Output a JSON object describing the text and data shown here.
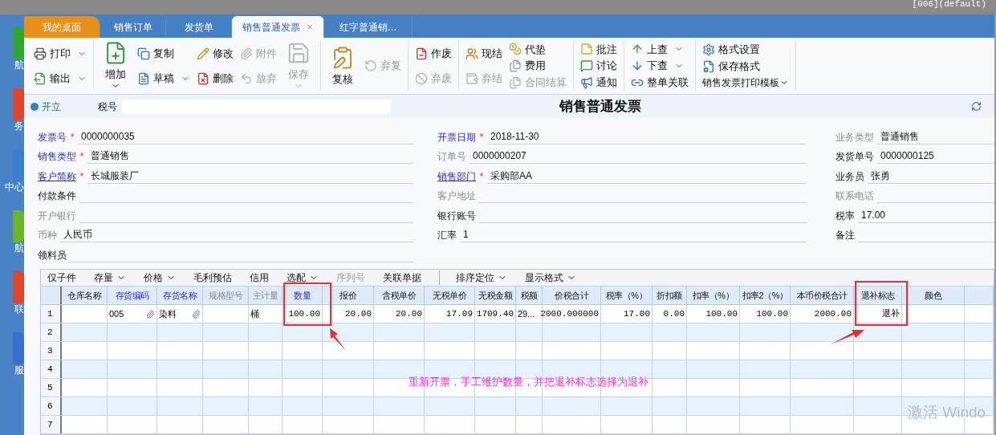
{
  "top_bar": {
    "text": "[006](default)"
  },
  "sidebar": {
    "items": [
      {
        "label": "航",
        "color": "#2fa82f"
      },
      {
        "label": "务",
        "color": "#e0452a"
      },
      {
        "label": "中心",
        "color": "#3a7fd0"
      },
      {
        "label": "航",
        "color": "#6bb52a"
      },
      {
        "label": "联",
        "color": "#e0452a"
      },
      {
        "label": "服",
        "color": "#3a6fd0"
      }
    ]
  },
  "tabs": [
    {
      "label": "我的桌面",
      "selected": false,
      "kind": "home"
    },
    {
      "label": "销售订单",
      "selected": false,
      "kind": "doc"
    },
    {
      "label": "发货单",
      "selected": false,
      "kind": "doc"
    },
    {
      "label": "销售普通发票",
      "selected": true,
      "kind": "doc",
      "close": "×"
    },
    {
      "label": "红字普通销…",
      "selected": false,
      "kind": "doc"
    }
  ],
  "toolbar": {
    "groups": [
      {
        "columns": [
          [
            {
              "label": "打印",
              "disabled": false,
              "dropdown": true
            },
            {
              "label": "输出",
              "disabled": false,
              "dropdown": true
            }
          ]
        ]
      },
      {
        "columns": [
          [
            {
              "label": "增加",
              "disabled": false,
              "dropdown": true,
              "kind": "big"
            }
          ],
          [
            {
              "label": "复制",
              "disabled": false,
              "dropdown": false
            },
            {
              "label": "草稿",
              "disabled": false,
              "dropdown": true
            }
          ],
          [
            {
              "label": "修改",
              "disabled": false,
              "dropdown": false
            },
            {
              "label": "删除",
              "disabled": false,
              "dropdown": false
            }
          ],
          [
            {
              "label": "附件",
              "disabled": true,
              "dropdown": false
            },
            {
              "label": "放弃",
              "disabled": true,
              "dropdown": false
            }
          ],
          [
            {
              "label": "保存",
              "disabled": true,
              "dropdown": true,
              "kind": "big"
            }
          ]
        ]
      },
      {
        "columns": [
          [
            {
              "label": "复核",
              "disabled": false,
              "dropdown": false,
              "kind": "big"
            }
          ],
          [
            {
              "label": "弃复",
              "disabled": true,
              "dropdown": false
            }
          ]
        ]
      },
      {
        "columns": [
          [
            {
              "label": "作废",
              "disabled": false,
              "dropdown": false
            },
            {
              "label": "弃废",
              "disabled": true,
              "dropdown": false
            }
          ]
        ]
      },
      {
        "columns": [
          [
            {
              "label": "现结",
              "disabled": false,
              "dropdown": false
            },
            {
              "label": "弃结",
              "disabled": true,
              "dropdown": false
            }
          ],
          [
            {
              "label": "代垫",
              "disabled": false,
              "dropdown": false
            },
            {
              "label": "费用",
              "disabled": false,
              "dropdown": false
            },
            {
              "label": "合同结算",
              "disabled": true,
              "dropdown": false
            }
          ]
        ]
      },
      {
        "columns": [
          [
            {
              "label": "批注",
              "disabled": false,
              "dropdown": false
            },
            {
              "label": "讨论",
              "disabled": false,
              "dropdown": false
            },
            {
              "label": "通知",
              "disabled": false,
              "dropdown": false
            }
          ]
        ]
      },
      {
        "columns": [
          [
            {
              "label": "上查",
              "disabled": false,
              "dropdown": true
            },
            {
              "label": "下查",
              "disabled": false,
              "dropdown": true
            },
            {
              "label": "整单关联",
              "disabled": false,
              "dropdown": false
            }
          ]
        ]
      },
      {
        "columns": [
          [
            {
              "label": "格式设置",
              "disabled": false,
              "dropdown": false
            },
            {
              "label": "保存格式",
              "disabled": false,
              "dropdown": false
            },
            {
              "label": "销售发票打印模板",
              "disabled": false,
              "dropdown": true,
              "kind": "plain"
            }
          ]
        ]
      }
    ]
  },
  "header": {
    "status": "开立",
    "tax_label": "税号",
    "title": "销售普通发票"
  },
  "form": {
    "columns": [
      [
        {
          "label": "发票号",
          "kind": "required",
          "required_mark": "*",
          "value": "0000000035"
        },
        {
          "label": "销售类型",
          "kind": "required",
          "required_mark": "*",
          "value": "普通销售"
        },
        {
          "label": "客户简称",
          "kind": "link",
          "required_mark": "*",
          "value": "长城服装厂"
        },
        {
          "label": "付款条件",
          "kind": "normal"
        },
        {
          "label": "开户银行",
          "kind": "muted"
        },
        {
          "label": "币种",
          "kind": "muted",
          "value": "人民币"
        },
        {
          "label": "领料员",
          "kind": "normal"
        }
      ],
      [
        {
          "label": "开票日期",
          "kind": "required",
          "required_mark": "*",
          "value": "2018-11-30"
        },
        {
          "label": "订单号",
          "kind": "muted",
          "value": "0000000207"
        },
        {
          "label": "销售部门",
          "kind": "link",
          "required_mark": "*",
          "value": "采购部AA"
        },
        {
          "label": "客户地址",
          "kind": "muted"
        },
        {
          "label": "银行账号",
          "kind": "normal"
        },
        {
          "label": "汇率",
          "kind": "normal",
          "value": "1"
        }
      ],
      [
        {
          "label": "业务类型",
          "kind": "muted",
          "value": "普通销售"
        },
        {
          "label": "发货单号",
          "kind": "normal",
          "value": "0000000125"
        },
        {
          "label": "业务员",
          "kind": "normal",
          "value": "张勇"
        },
        {
          "label": "联系电话",
          "kind": "muted"
        },
        {
          "label": "税率",
          "kind": "normal",
          "value": "17.00"
        },
        {
          "label": "备注",
          "kind": "normal"
        }
      ]
    ]
  },
  "grid": {
    "toolbar": [
      {
        "label": "仅子件",
        "dropdown": false,
        "disabled": false
      },
      {
        "label": "存量",
        "dropdown": true,
        "disabled": false
      },
      {
        "label": "价格",
        "dropdown": true,
        "disabled": false
      },
      {
        "label": "毛利预估",
        "dropdown": false,
        "disabled": false
      },
      {
        "label": "信用",
        "dropdown": false,
        "disabled": false
      },
      {
        "label": "选配",
        "dropdown": true,
        "disabled": false
      },
      {
        "label": "序列号",
        "dropdown": false,
        "disabled": true
      },
      {
        "label": "关联单据",
        "dropdown": false,
        "disabled": false
      },
      {
        "label": "排序定位",
        "dropdown": true,
        "disabled": false,
        "separator": true
      },
      {
        "label": "显示格式",
        "dropdown": true,
        "disabled": false
      }
    ],
    "columns": [
      {
        "label": "仓库名称",
        "kind": "normal"
      },
      {
        "label": "存货编码",
        "kind": "link"
      },
      {
        "label": "存货名称",
        "kind": "link"
      },
      {
        "label": "规格型号",
        "kind": "muted"
      },
      {
        "label": "主计量",
        "kind": "muted"
      },
      {
        "label": "数量",
        "kind": "link"
      },
      {
        "label": "报价",
        "kind": "normal"
      },
      {
        "label": "含税单价",
        "kind": "normal"
      },
      {
        "label": "无税单价",
        "kind": "normal"
      },
      {
        "label": "无税金额",
        "kind": "normal"
      },
      {
        "label": "税额",
        "kind": "normal"
      },
      {
        "label": "价税合计",
        "kind": "normal"
      },
      {
        "label": "税率（%）",
        "kind": "normal"
      },
      {
        "label": "折扣额",
        "kind": "normal"
      },
      {
        "label": "扣率（%）",
        "kind": "normal"
      },
      {
        "label": "扣率2（%）",
        "kind": "normal"
      },
      {
        "label": "本币价税合计",
        "kind": "normal"
      },
      {
        "label": "退补标志",
        "kind": "normal"
      },
      {
        "label": "颜色",
        "kind": "normal"
      },
      {
        "kind": "normal"
      }
    ],
    "rows": [
      {
        "number": "1",
        "cells": [
          null,
          {
            "text": "005",
            "clip": true
          },
          {
            "text": "染料",
            "clip": true
          },
          null,
          {
            "text": "桶"
          },
          {
            "text": "100.00",
            "num": true
          },
          {
            "text": "20.00",
            "num": true
          },
          {
            "text": "20.00",
            "num": true
          },
          {
            "text": "17.09",
            "num": true
          },
          {
            "text": "1709.40",
            "num": true
          },
          {
            "text": "29..."
          },
          {
            "text": "2000.000000",
            "num": true
          },
          {
            "text": "17.00",
            "num": true
          },
          {
            "text": "0.00",
            "num": true
          },
          {
            "text": "100.00",
            "num": true
          },
          {
            "text": "100.00",
            "num": true
          },
          {
            "text": "2000.00",
            "num": true
          },
          {
            "text": "退补",
            "num": true
          },
          null,
          null
        ]
      },
      {
        "number": "2"
      },
      {
        "number": "3"
      },
      {
        "number": "4"
      },
      {
        "number": "5"
      },
      {
        "number": "6"
      },
      {
        "number": "7"
      }
    ]
  },
  "annotation": {
    "note": "重新开票，手工维护数量，并把退补标志选择为退补"
  },
  "os_watermark": "激活 Windo"
}
